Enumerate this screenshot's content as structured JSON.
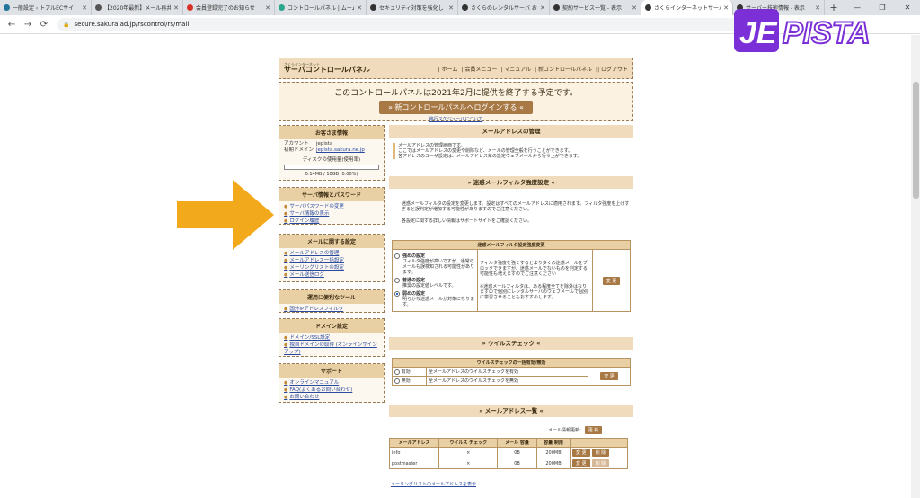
{
  "browser": {
    "tabs": [
      {
        "title": "一般設定 ‹ トアルECサイ",
        "color": "#21759b"
      },
      {
        "title": "【2020年最新】メール再共",
        "color": "#555555"
      },
      {
        "title": "会員登録完了のお知らせ",
        "color": "#d93025"
      },
      {
        "title": "コントロールパネル | ムーム",
        "color": "#2ca58d"
      },
      {
        "title": "セキュリティ対策を強化し",
        "color": "#333333"
      },
      {
        "title": "さくらのレンタルサーバ お",
        "color": "#333333"
      },
      {
        "title": "契約サービス一覧 - 表示",
        "color": "#333333"
      },
      {
        "title": "さくらインターネットサーバ",
        "color": "#333333"
      },
      {
        "title": "サーバー技術情報 - 表示",
        "color": "#333333"
      }
    ],
    "active_tab": 7,
    "url": "secure.sakura.ad.jp/rscontrol/rs/mail",
    "nav": {
      "back": "←",
      "forward": "→",
      "reload": "⟳",
      "lock": "🔒"
    },
    "window": {
      "min": "—",
      "max": "❐",
      "close": "✕"
    }
  },
  "logo": {
    "text": "JEPISTA"
  },
  "header": {
    "brand_small": "さくらインターネット",
    "brand": "サーバコントロールパネル",
    "nav": [
      "| ホーム",
      "| 会員メニュー",
      "| マニュアル",
      "| 新コントロールパネル",
      "|| ログアウト"
    ]
  },
  "notice": {
    "message": "このコントロールパネルは2021年2月に提供を終了する予定です。",
    "button": "» 新コントロールパネルへログインする «",
    "link": "移行スケジュールについて"
  },
  "customer": {
    "title": "お客さま情報",
    "account_label": "アカウント",
    "account_value": "jepista",
    "domain_label": "初期ドメイン",
    "domain_value": "jepista.sakura.ne.jp",
    "disk_label": "ディスクの使用量(使用率)",
    "disk_value": "0.14MB / 10GB (0.00%)"
  },
  "server_pw": {
    "title": "サーバ情報とパスワード",
    "links": [
      "サーバパスワードの変更",
      "サーバ情報の表示",
      "ログイン履歴"
    ]
  },
  "mail_settings": {
    "title": "メールに関する設定",
    "links": [
      "メールアドレスの管理",
      "メールアドレス一括設定",
      "メーリングリストの設定",
      "メール送信ログ"
    ]
  },
  "tools": {
    "title": "運用に便利なツール",
    "links": [
      "国外IPアドレスフィルタ"
    ]
  },
  "domain_set": {
    "title": "ドメイン設定",
    "links": [
      "ドメイン/SSL設定",
      "独自ドメインの取得 (オンラインサインアップ)"
    ]
  },
  "support": {
    "title": "サポート",
    "links": [
      "オンラインマニュアル",
      "FAQ(よくあるお問い合わせ)",
      "お問い合わせ"
    ]
  },
  "mail_mgmt": {
    "title": "メールアドレスの管理",
    "desc": [
      "メールアドレスの管理画面です。",
      "ここではメールアドレスの変更や削除など、メールの管理全般を行うことができます。",
      "各アドレスのユーザ設定は、メールアドレス毎の設定ウェブメールから行う上ができます。"
    ]
  },
  "spam": {
    "title": "» 迷惑メールフィルタ強度設定 «",
    "desc1": "迷惑メールフィルタの設定を変更します。設定はすべてのメールアドレスに適用されます。フィルタ強度を上げすぎると誤判定が増加する可能性がありますのでご注意ください。",
    "desc2": "各設定に関する詳しい情報はサポートサイトをご確認ください。",
    "table_title": "迷惑メールフィルタ設定強度変更",
    "options": [
      {
        "name": "強めの設定",
        "desc": "フィルタ強度が高いですが、通常のメールも誤検知される可能性があります。",
        "on": false
      },
      {
        "name": "普通の設定",
        "desc": "推奨の設定値レベルです。",
        "on": false
      },
      {
        "name": "弱めの設定",
        "desc": "明らかな迷惑メールが対象になります。",
        "on": true
      }
    ],
    "note1": "フィルタ強度を強くするとより多くの迷惑メールをブロックできますが、迷惑メールでないものを判定する可能性も増えますのでご注意ください",
    "note2": "※迷惑メールフィルタは、ある程度全てを除外はなりますので個別にレンタルサーバのウェブメールで個別に学習させることもおすすめします。",
    "button": "変 更"
  },
  "virus": {
    "title": "» ウイルスチェック «",
    "table_title": "ウイルスチェックの一括有効/無効",
    "rows": [
      {
        "label": "有効",
        "desc": "全メールアドレスのウイルスチェックを有効"
      },
      {
        "label": "無効",
        "desc": "全メールアドレスのウイルスチェックを無効"
      }
    ],
    "button": "変 更"
  },
  "list": {
    "title": "» メールアドレス一覧 «",
    "update_label": "メール情報更新:",
    "update_btn": "更 新",
    "headers": [
      "メールアドレス",
      "ウイルス チェック",
      "メール 容量",
      "容量 制限",
      ""
    ],
    "rows": [
      {
        "addr": "info",
        "virus": "×",
        "size": "0B",
        "limit": "200MB"
      },
      {
        "addr": "postmaster",
        "virus": "×",
        "size": "0B",
        "limit": "200MB"
      }
    ],
    "edit": "変 更",
    "del": "削 除",
    "footer_link": "メーリングリストのメールアドレスを表示"
  }
}
